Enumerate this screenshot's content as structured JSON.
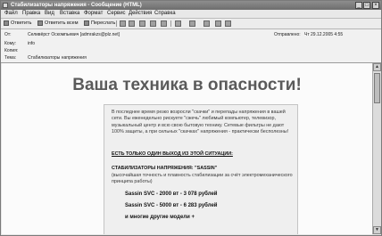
{
  "window": {
    "title": "Стабилизаторы напряжения - Сообщение (HTML)",
    "controls": [
      "_",
      "□",
      "×"
    ]
  },
  "menu": [
    "Файл",
    "Правка",
    "Вид",
    "Вставка",
    "Формат",
    "Сервис",
    "Действия",
    "Справка"
  ],
  "toolbar": {
    "reply": "Ответить",
    "reply_all": "Ответить всем",
    "forward": "Переслать"
  },
  "header": {
    "from_label": "От:",
    "from_value": "Селивёрст Оскомпьевич [admrakzs@plz.net]",
    "sent_label": "Отправлено:",
    "sent_value": "Чт 29.12.2005 4:55",
    "to_label": "Кому:",
    "to_value": "info",
    "cc_label": "Копия:",
    "cc_value": "",
    "subject_label": "Тема:",
    "subject_value": "Стабилизаторы напряжения"
  },
  "message": {
    "headline": "Ваша техника в опасности!",
    "paragraph1": "В последнее время резко возросли \"скачки\" и перепады напряжения в вашей сети. Вы еженедельно рискуете \"сжечь\" любимый компьютер, телевизор, музыкальный центр и всю свою бытовую технику. Сетевые фильтры не дают 100% защиты, а при сильных \"скачках\" напряжения - практически бесполезны!",
    "only_one_way": "ЕСТЬ ТОЛЬКО ОДИН ВЫХОД ИЗ ЭТОЙ СИТУАЦИИ:",
    "stabilizers_title": "СТАБИЛИЗАТОРЫ НАПРЯЖЕНИЯ: \"SASSIN\"",
    "stabilizers_desc": "(высочайшая точность и плавность стабилизации за счёт электромеханического принципа работы)",
    "price1": "Sassin SVC - 2000 вт - 3 078 рублей",
    "price2": "Sassin SVC - 5000 вт - 6 283 рублей",
    "more": "и многие другие модели +"
  }
}
